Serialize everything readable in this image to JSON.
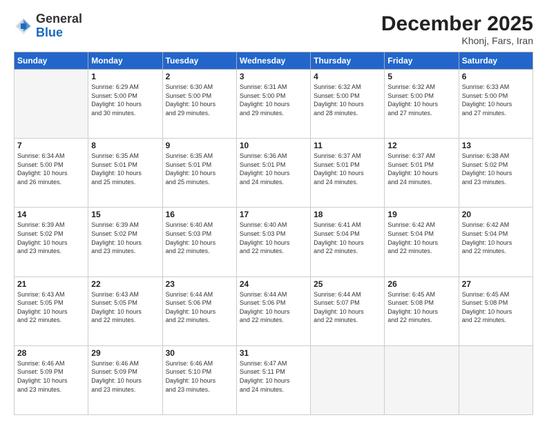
{
  "logo": {
    "general": "General",
    "blue": "Blue"
  },
  "header": {
    "month_year": "December 2025",
    "location": "Khonj, Fars, Iran"
  },
  "days_of_week": [
    "Sunday",
    "Monday",
    "Tuesday",
    "Wednesday",
    "Thursday",
    "Friday",
    "Saturday"
  ],
  "weeks": [
    [
      {
        "day": "",
        "info": ""
      },
      {
        "day": "1",
        "info": "Sunrise: 6:29 AM\nSunset: 5:00 PM\nDaylight: 10 hours\nand 30 minutes."
      },
      {
        "day": "2",
        "info": "Sunrise: 6:30 AM\nSunset: 5:00 PM\nDaylight: 10 hours\nand 29 minutes."
      },
      {
        "day": "3",
        "info": "Sunrise: 6:31 AM\nSunset: 5:00 PM\nDaylight: 10 hours\nand 29 minutes."
      },
      {
        "day": "4",
        "info": "Sunrise: 6:32 AM\nSunset: 5:00 PM\nDaylight: 10 hours\nand 28 minutes."
      },
      {
        "day": "5",
        "info": "Sunrise: 6:32 AM\nSunset: 5:00 PM\nDaylight: 10 hours\nand 27 minutes."
      },
      {
        "day": "6",
        "info": "Sunrise: 6:33 AM\nSunset: 5:00 PM\nDaylight: 10 hours\nand 27 minutes."
      }
    ],
    [
      {
        "day": "7",
        "info": "Sunrise: 6:34 AM\nSunset: 5:00 PM\nDaylight: 10 hours\nand 26 minutes."
      },
      {
        "day": "8",
        "info": "Sunrise: 6:35 AM\nSunset: 5:01 PM\nDaylight: 10 hours\nand 25 minutes."
      },
      {
        "day": "9",
        "info": "Sunrise: 6:35 AM\nSunset: 5:01 PM\nDaylight: 10 hours\nand 25 minutes."
      },
      {
        "day": "10",
        "info": "Sunrise: 6:36 AM\nSunset: 5:01 PM\nDaylight: 10 hours\nand 24 minutes."
      },
      {
        "day": "11",
        "info": "Sunrise: 6:37 AM\nSunset: 5:01 PM\nDaylight: 10 hours\nand 24 minutes."
      },
      {
        "day": "12",
        "info": "Sunrise: 6:37 AM\nSunset: 5:01 PM\nDaylight: 10 hours\nand 24 minutes."
      },
      {
        "day": "13",
        "info": "Sunrise: 6:38 AM\nSunset: 5:02 PM\nDaylight: 10 hours\nand 23 minutes."
      }
    ],
    [
      {
        "day": "14",
        "info": "Sunrise: 6:39 AM\nSunset: 5:02 PM\nDaylight: 10 hours\nand 23 minutes."
      },
      {
        "day": "15",
        "info": "Sunrise: 6:39 AM\nSunset: 5:02 PM\nDaylight: 10 hours\nand 23 minutes."
      },
      {
        "day": "16",
        "info": "Sunrise: 6:40 AM\nSunset: 5:03 PM\nDaylight: 10 hours\nand 22 minutes."
      },
      {
        "day": "17",
        "info": "Sunrise: 6:40 AM\nSunset: 5:03 PM\nDaylight: 10 hours\nand 22 minutes."
      },
      {
        "day": "18",
        "info": "Sunrise: 6:41 AM\nSunset: 5:04 PM\nDaylight: 10 hours\nand 22 minutes."
      },
      {
        "day": "19",
        "info": "Sunrise: 6:42 AM\nSunset: 5:04 PM\nDaylight: 10 hours\nand 22 minutes."
      },
      {
        "day": "20",
        "info": "Sunrise: 6:42 AM\nSunset: 5:04 PM\nDaylight: 10 hours\nand 22 minutes."
      }
    ],
    [
      {
        "day": "21",
        "info": "Sunrise: 6:43 AM\nSunset: 5:05 PM\nDaylight: 10 hours\nand 22 minutes."
      },
      {
        "day": "22",
        "info": "Sunrise: 6:43 AM\nSunset: 5:05 PM\nDaylight: 10 hours\nand 22 minutes."
      },
      {
        "day": "23",
        "info": "Sunrise: 6:44 AM\nSunset: 5:06 PM\nDaylight: 10 hours\nand 22 minutes."
      },
      {
        "day": "24",
        "info": "Sunrise: 6:44 AM\nSunset: 5:06 PM\nDaylight: 10 hours\nand 22 minutes."
      },
      {
        "day": "25",
        "info": "Sunrise: 6:44 AM\nSunset: 5:07 PM\nDaylight: 10 hours\nand 22 minutes."
      },
      {
        "day": "26",
        "info": "Sunrise: 6:45 AM\nSunset: 5:08 PM\nDaylight: 10 hours\nand 22 minutes."
      },
      {
        "day": "27",
        "info": "Sunrise: 6:45 AM\nSunset: 5:08 PM\nDaylight: 10 hours\nand 22 minutes."
      }
    ],
    [
      {
        "day": "28",
        "info": "Sunrise: 6:46 AM\nSunset: 5:09 PM\nDaylight: 10 hours\nand 23 minutes."
      },
      {
        "day": "29",
        "info": "Sunrise: 6:46 AM\nSunset: 5:09 PM\nDaylight: 10 hours\nand 23 minutes."
      },
      {
        "day": "30",
        "info": "Sunrise: 6:46 AM\nSunset: 5:10 PM\nDaylight: 10 hours\nand 23 minutes."
      },
      {
        "day": "31",
        "info": "Sunrise: 6:47 AM\nSunset: 5:11 PM\nDaylight: 10 hours\nand 24 minutes."
      },
      {
        "day": "",
        "info": ""
      },
      {
        "day": "",
        "info": ""
      },
      {
        "day": "",
        "info": ""
      }
    ]
  ]
}
